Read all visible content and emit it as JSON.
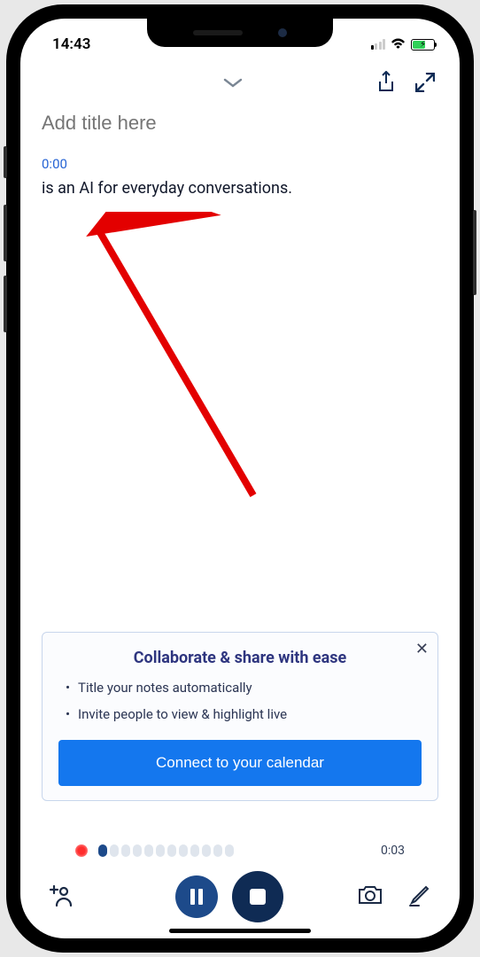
{
  "status": {
    "time": "14:43"
  },
  "note": {
    "title_placeholder": "Add title here",
    "timestamp": "0:00",
    "transcript": "is an AI for everyday conversations."
  },
  "promo": {
    "title": "Collaborate & share with ease",
    "bullets": [
      "Title your notes automatically",
      "Invite people to view & highlight live"
    ],
    "cta": "Connect to your calendar"
  },
  "player": {
    "elapsed": "0:03"
  }
}
